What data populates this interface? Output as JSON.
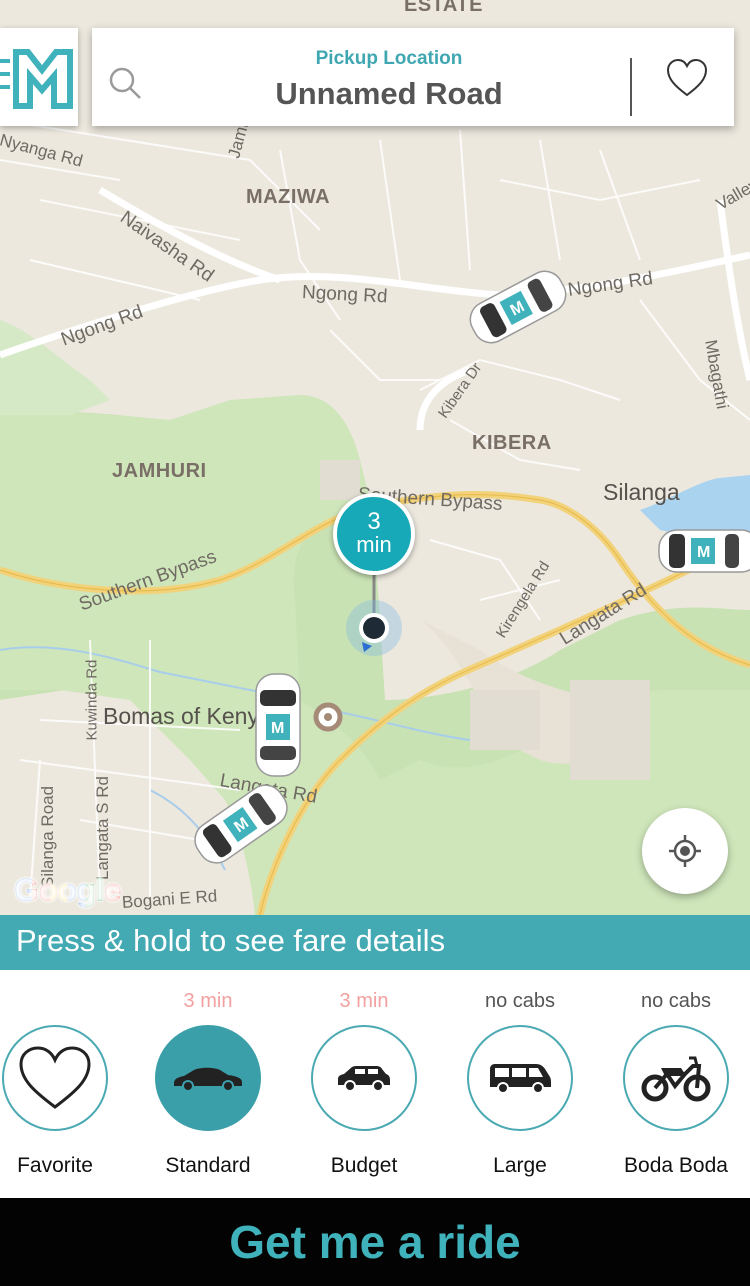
{
  "map": {
    "top_label": "ESTATE",
    "areas": [
      "MAZIWA",
      "KIBERA",
      "JAMHURI"
    ],
    "places": [
      "Silanga",
      "Bomas of Kenya"
    ],
    "roads": [
      "Ngong Rd",
      "Naivasha Rd",
      "Ngong Rd",
      "Ngong Rd",
      "Kibera Dr",
      "Southern Bypass",
      "Southern Bypass",
      "Langata Rd",
      "Kirengela Rd",
      "Langata Rd",
      "Kuwinda Rd",
      "Silanga Road",
      "Langata S Rd",
      "Bogani E Rd",
      "Mbagathi",
      "Valley",
      "Jamhuri",
      "Nyanga Rd"
    ],
    "google_logo": "Google",
    "eta_value": "3",
    "eta_unit": "min"
  },
  "header": {
    "pickup_title": "Pickup Location",
    "pickup_value": "Unnamed Road"
  },
  "fare_banner": "Press & hold to see fare details",
  "options": [
    {
      "eta": "",
      "label": "Favorite",
      "icon": "heart-icon",
      "selected": false
    },
    {
      "eta": "3 min",
      "label": "Standard",
      "icon": "sedan-icon",
      "selected": true
    },
    {
      "eta": "3 min",
      "label": "Budget",
      "icon": "hatchback-icon",
      "selected": false
    },
    {
      "eta": "no cabs",
      "label": "Large",
      "icon": "van-icon",
      "selected": false
    },
    {
      "eta": "no cabs",
      "label": "Boda Boda",
      "icon": "motorbike-icon",
      "selected": false
    }
  ],
  "cta_label": "Get me a ride",
  "colors": {
    "accent": "#43a9b3",
    "eta_available": "#f2a0a0",
    "cta_bg": "#030303",
    "cta_text": "#3fb2bb"
  }
}
